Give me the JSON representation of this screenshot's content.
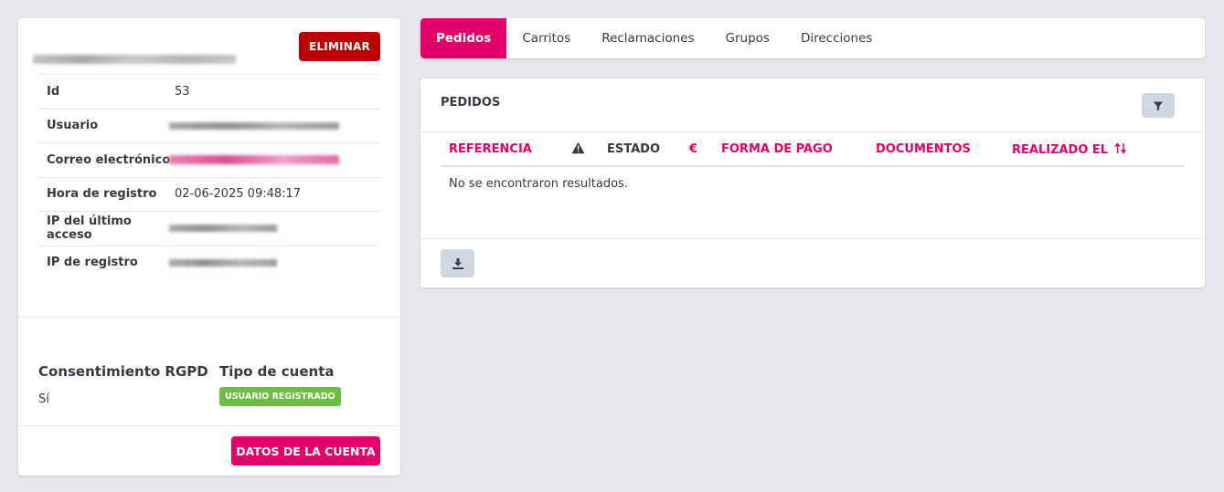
{
  "customer": {
    "delete_label": "ELIMINAR",
    "rows": [
      {
        "label": "Id",
        "value": "53"
      },
      {
        "label": "Usuario",
        "value": ""
      },
      {
        "label": "Correo electrónico",
        "value": ""
      },
      {
        "label": "Hora de registro",
        "value": "02-06-2025 09:48:17"
      },
      {
        "label": "IP del último acceso",
        "value": ""
      },
      {
        "label": "IP de registro",
        "value": ""
      }
    ],
    "gdpr_title": "Consentimiento RGPD",
    "gdpr_value": "Sí",
    "account_type_title": "Tipo de cuenta",
    "account_type_badge": "USUARIO REGISTRADO",
    "account_button": "DATOS DE LA CUENTA"
  },
  "tabs": [
    {
      "label": "Pedidos",
      "active": true
    },
    {
      "label": "Carritos",
      "active": false
    },
    {
      "label": "Reclamaciones",
      "active": false
    },
    {
      "label": "Grupos",
      "active": false
    },
    {
      "label": "Direcciones",
      "active": false
    }
  ],
  "orders": {
    "title": "PEDIDOS",
    "columns": {
      "reference": "REFERENCIA",
      "status": "ESTADO",
      "currency_symbol": "€",
      "payment": "FORMA DE PAGO",
      "documents": "DOCUMENTOS",
      "placed_on": "REALIZADO EL"
    },
    "empty_message": "No se encontraron resultados."
  },
  "colors": {
    "accent": "#e40069",
    "danger": "#bd0000",
    "success": "#6dbd43",
    "background": "#e6e7ec"
  },
  "icons": {
    "warning": "warning-icon",
    "filter": "filter-icon",
    "download": "download-icon",
    "sort": "sort-icon"
  }
}
